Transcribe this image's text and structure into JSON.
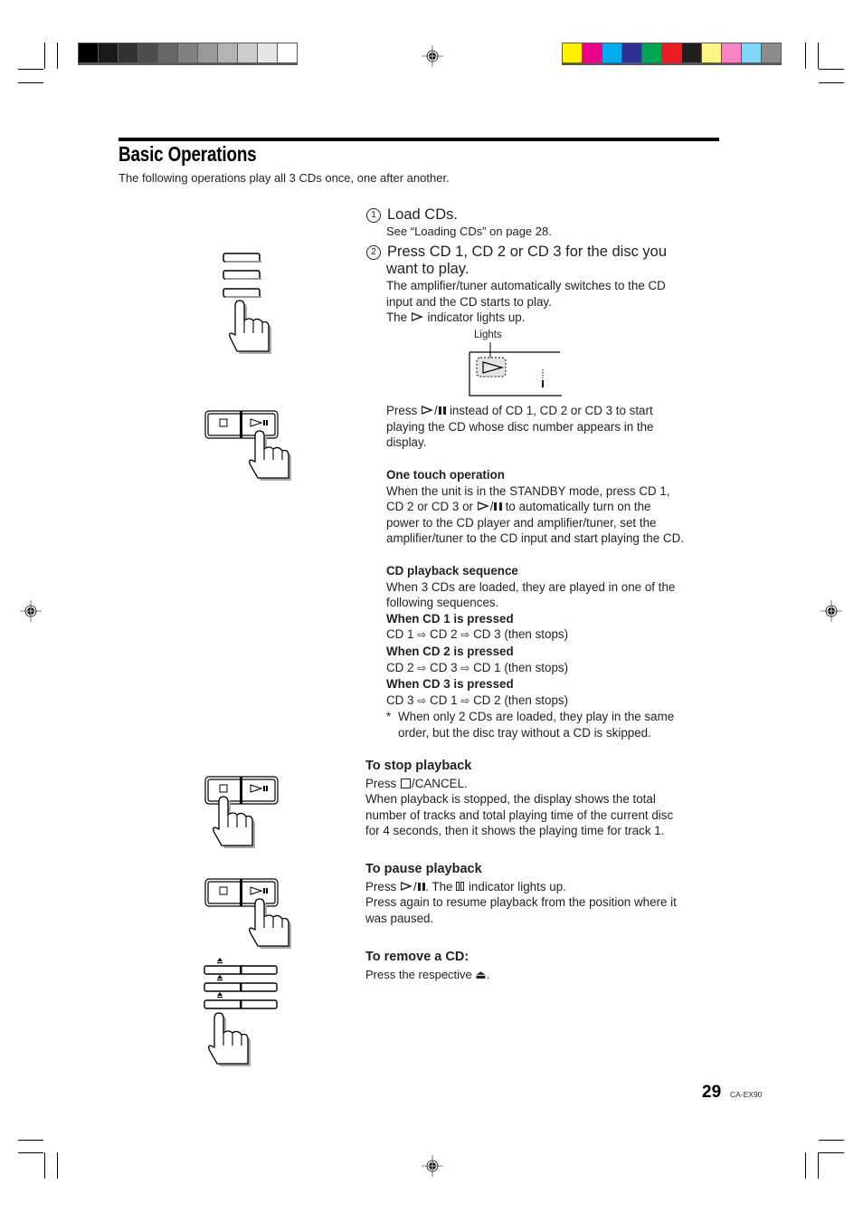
{
  "print_marks": {
    "grayscale_swatches": [
      "#000000",
      "#1a1a1a",
      "#333333",
      "#4d4d4d",
      "#666666",
      "#808080",
      "#999999",
      "#b3b3b3",
      "#cccccc",
      "#e6e6e6",
      "#ffffff"
    ],
    "color_swatches": [
      "#fff100",
      "#ec008c",
      "#00aeef",
      "#2e3192",
      "#00a651",
      "#ed1c24",
      "#231f20",
      "#fff685",
      "#f683c4",
      "#7fd6f7",
      "#8c8c8c"
    ]
  },
  "header": {
    "title": "Basic Operations",
    "intro": "The following operations play all 3 CDs once, one after another."
  },
  "steps": [
    {
      "number": "1",
      "title": "Load CDs.",
      "lines": [
        "See “Loading CDs” on page 28."
      ]
    },
    {
      "number": "2",
      "title_line1": "Press CD 1, CD 2 or CD 3 for the disc you",
      "title_line2": "want to play.",
      "lines": [
        "The amplifier/tuner automatically switches to the CD",
        "input and the CD starts to play."
      ],
      "indicator_pre": "The",
      "indicator_post": "indicator lights up."
    }
  ],
  "display_diagram": {
    "label": "Lights"
  },
  "press_play_note": {
    "pre": "Press",
    "line1_post": "instead of CD 1, CD 2 or CD 3 to start",
    "line2": "playing the CD whose disc number appears in the",
    "line3": "display."
  },
  "one_touch": {
    "heading": "One touch operation",
    "line1": "When the unit is in the STANDBY mode, press CD 1,",
    "line2_pre": "CD 2 or CD 3 or",
    "line2_post": "to automatically turn on the",
    "line3": "power to the CD player and amplifier/tuner, set the",
    "line4": "amplifier/tuner to the CD input and start playing the CD."
  },
  "sequence": {
    "heading": "CD playback sequence",
    "line1": "When 3 CDs are loaded, they are played in one of the",
    "line2": "following sequences.",
    "arrow": "⇨",
    "cases": [
      {
        "heading": "When CD 1 is pressed",
        "order": [
          "CD 1",
          "CD 2",
          "CD 3"
        ],
        "suffix": "(then stops)"
      },
      {
        "heading": "When CD 2 is pressed",
        "order": [
          "CD 2",
          "CD 3",
          "CD 1"
        ],
        "suffix": "(then stops)"
      },
      {
        "heading": "When CD 3 is pressed",
        "order": [
          "CD 3",
          "CD 1",
          "CD 2"
        ],
        "suffix": "(then stops)"
      }
    ],
    "note_marker": "*",
    "note_line1": "When only 2 CDs are loaded, they play in the same",
    "note_line2": "order, but the disc tray without a CD is skipped."
  },
  "stop": {
    "heading": "To stop playback",
    "press_pre": "Press",
    "press_post": "/CANCEL.",
    "line1": "When playback is stopped, the display shows the total",
    "line2": "number of tracks and total playing time of the current disc",
    "line3": "for 4 seconds, then it shows the playing time for track 1."
  },
  "pause": {
    "heading": "To pause playback",
    "press_pre": "Press",
    "press_mid": ". The",
    "press_post": "indicator lights up.",
    "line2": "Press again to resume playback from the position where it",
    "line3": "was paused."
  },
  "remove": {
    "heading": "To remove a CD:",
    "text_pre": "Press the respective",
    "eject_symbol": "⏏",
    "text_post": "."
  },
  "footer": {
    "page_number": "29",
    "model": "CA-EX90"
  }
}
